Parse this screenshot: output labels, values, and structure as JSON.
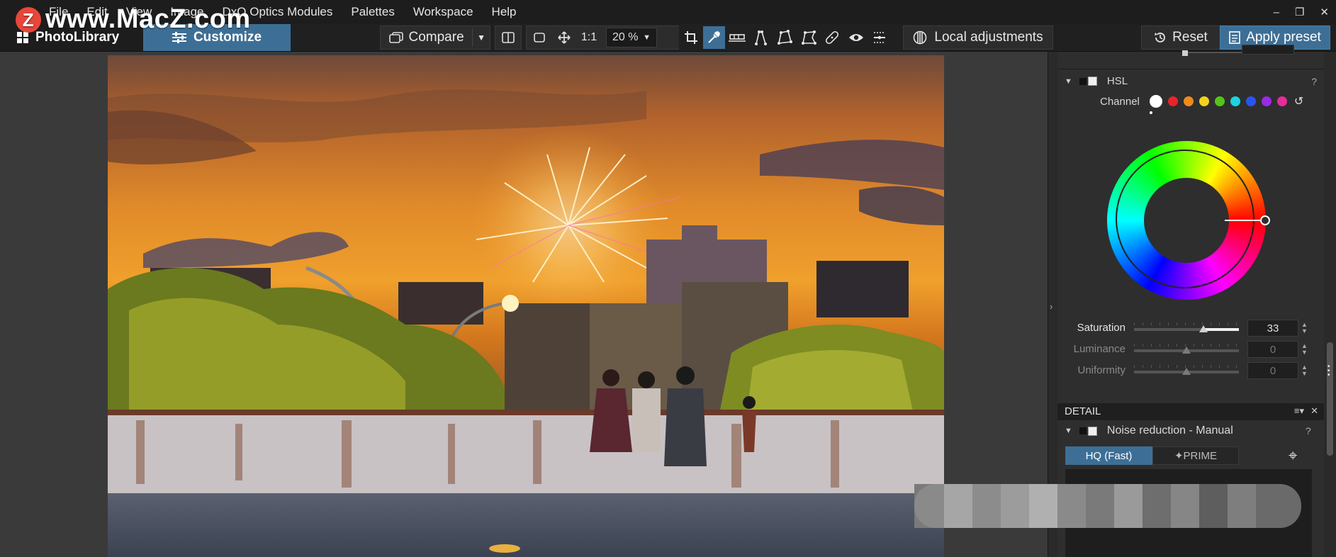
{
  "watermark": {
    "text": "www.MacZ.com",
    "badge": "Z"
  },
  "menu": {
    "items": [
      "File",
      "Edit",
      "View",
      "Image",
      "DxO Optics Modules",
      "Palettes",
      "Workspace",
      "Help"
    ],
    "window_controls": [
      "–",
      "❐",
      "✕"
    ]
  },
  "tabs": {
    "photolibrary": "PhotoLibrary",
    "customize": "Customize"
  },
  "toolbar": {
    "compare": "Compare",
    "one_to_one": "1:1",
    "zoom": "20 %",
    "local_adjustments": "Local adjustments",
    "reset": "Reset",
    "apply_preset": "Apply preset"
  },
  "hsl": {
    "title": "HSL",
    "help": "?",
    "channel_label": "Channel",
    "channel_colors": [
      "#ffffff",
      "#e8242b",
      "#f08a1a",
      "#f4d21c",
      "#52c41a",
      "#1ed2e0",
      "#2a54f0",
      "#9a2ae8",
      "#e82a9a"
    ],
    "sliders": [
      {
        "label": "Saturation",
        "value": "33",
        "fraction": 0.66,
        "enabled": true
      },
      {
        "label": "Luminance",
        "value": "0",
        "fraction": 0.5,
        "enabled": false
      },
      {
        "label": "Uniformity",
        "value": "0",
        "fraction": 0.5,
        "enabled": false
      }
    ]
  },
  "detail": {
    "section_title": "DETAIL",
    "noise_reduction_title": "Noise reduction - Manual",
    "help": "?",
    "modes": [
      "HQ (Fast)",
      "✦PRIME"
    ],
    "selected_mode": "HQ (Fast)"
  },
  "colors": {
    "accent": "#3d6f96",
    "menubar": "#1d1d1d",
    "panel": "#2e2e2e",
    "viewer": "#3a3a3a"
  }
}
